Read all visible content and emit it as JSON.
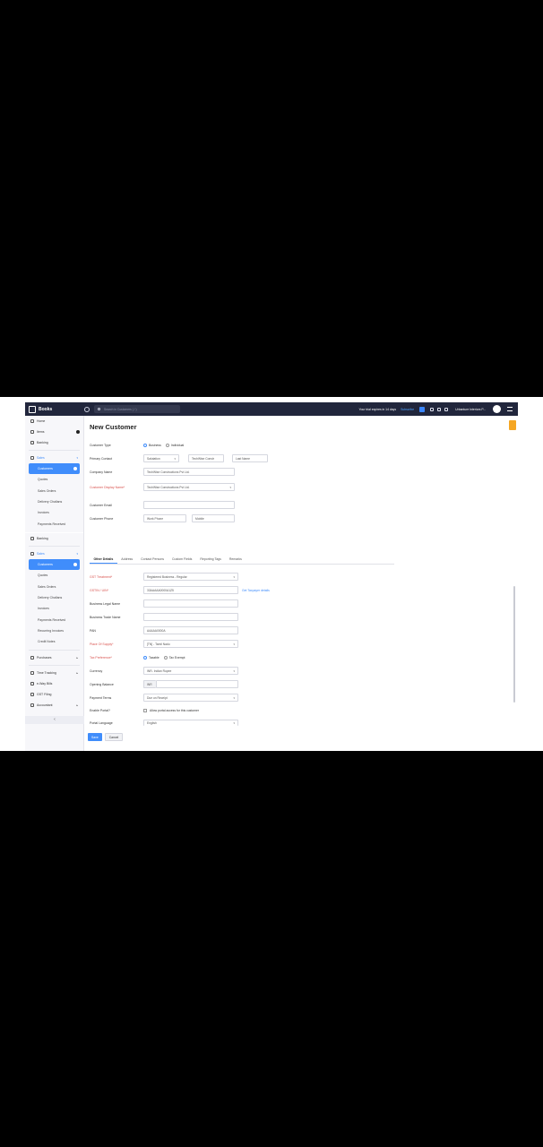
{
  "topbar": {
    "app_name": "Books",
    "search_placeholder": "Search in Customers ( / )",
    "trial": "Your trial expires in 14 days",
    "subscribe": "Subscribe",
    "org": "Urbanture Interiors P..."
  },
  "sidebar_top": [
    {
      "label": "Home",
      "icon": "home-icon"
    },
    {
      "label": "Items",
      "icon": "items-icon"
    },
    {
      "label": "Banking",
      "icon": "bank-icon"
    }
  ],
  "sidebar_sales": {
    "group": "Sales",
    "items": [
      "Customers",
      "Quotes",
      "Sales Orders",
      "Delivery Challans",
      "Invoices",
      "Payments Received"
    ]
  },
  "sidebar_bottom": {
    "banking": "Banking",
    "group": "Sales",
    "items": [
      "Customers",
      "Quotes",
      "Sales Orders",
      "Delivery Challans",
      "Invoices",
      "Payments Received",
      "Recurring Invoices",
      "Credit Notes"
    ],
    "more": [
      "Purchases",
      "Time Tracking",
      "e-Way Bills",
      "GST Filing",
      "Accountant"
    ]
  },
  "page": {
    "title": "New Customer"
  },
  "form": {
    "customer_type": {
      "label": "Customer Type",
      "opt1": "Business",
      "opt2": "Individual"
    },
    "primary_contact": {
      "label": "Primary Contact",
      "salutation": "Salutation",
      "first": "TechWise Constr",
      "last": "Last Name"
    },
    "company": {
      "label": "Company Name",
      "value": "TechWise Constructions Pvt Ltd."
    },
    "display": {
      "label": "Customer Display Name*",
      "value": "TechWise Constructions Pvt Ltd."
    },
    "email": {
      "label": "Customer Email",
      "value": ""
    },
    "phone": {
      "label": "Customer Phone",
      "work": "Work Phone",
      "mobile": "Mobile"
    }
  },
  "tabs": [
    "Other Details",
    "Address",
    "Contact Persons",
    "Custom Fields",
    "Reporting Tags",
    "Remarks"
  ],
  "other": {
    "gst_treatment": {
      "label": "GST Treatment*",
      "value": "Registered Business - Regular"
    },
    "gstin": {
      "label": "GSTIN / UIN*",
      "value": "33AAAAA0000A1Z5",
      "link": "Get Taxpayer details"
    },
    "legal": {
      "label": "Business Legal Name",
      "value": ""
    },
    "trade": {
      "label": "Business Trade Name",
      "value": ""
    },
    "pan": {
      "label": "PAN",
      "value": "AAAAA0000A"
    },
    "place": {
      "label": "Place Of Supply*",
      "value": "[TN] - Tamil Nadu"
    },
    "tax": {
      "label": "Tax Preference*",
      "opt1": "Taxable",
      "opt2": "Tax Exempt"
    },
    "currency": {
      "label": "Currency",
      "value": "INR- Indian Rupee"
    },
    "opening": {
      "label": "Opening Balance",
      "prefix": "INR",
      "value": ""
    },
    "terms": {
      "label": "Payment Terms",
      "value": "Due on Receipt"
    },
    "portal": {
      "label": "Enable Portal?",
      "text": "Allow portal access for this customer"
    },
    "language": {
      "label": "Portal Language",
      "value": "English"
    }
  },
  "buttons": {
    "save": "Save",
    "cancel": "Cancel"
  },
  "colors": {
    "accent": "#408dfb",
    "topbar": "#21263c",
    "required": "#d9534f"
  }
}
